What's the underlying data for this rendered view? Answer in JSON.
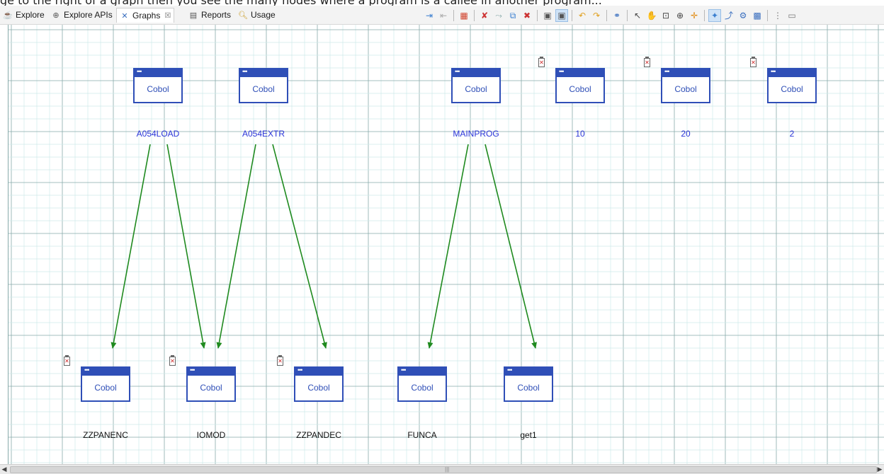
{
  "tabs": [
    {
      "label": "Explore",
      "icon": "cup-icon"
    },
    {
      "label": "Explore APIs",
      "icon": "api-icon"
    },
    {
      "label": "Graphs",
      "icon": "graph-icon",
      "close": "☒"
    },
    {
      "label": "Reports",
      "icon": "report-icon"
    },
    {
      "label": "Usage",
      "icon": "usage-icon"
    }
  ],
  "topcut_text": "ge to the right of a graph then you see the many nodes where a program is a callee in another program...",
  "graph": {
    "nodes": [
      {
        "id": "A054LOAD",
        "box_label": "Cobol",
        "name": "A054LOAD",
        "error": false,
        "label_color": "blue"
      },
      {
        "id": "A054EXTR",
        "box_label": "Cobol",
        "name": "A054EXTR",
        "error": false,
        "label_color": "blue"
      },
      {
        "id": "MAINPROG",
        "box_label": "Cobol",
        "name": "MAINPROG",
        "error": false,
        "label_color": "blue"
      },
      {
        "id": "10",
        "box_label": "Cobol",
        "name": "10",
        "error": true,
        "label_color": "blue"
      },
      {
        "id": "20",
        "box_label": "Cobol",
        "name": "20",
        "error": true,
        "label_color": "blue"
      },
      {
        "id": "2",
        "box_label": "Cobol",
        "name": "2",
        "error": true,
        "label_color": "blue"
      },
      {
        "id": "ZZPANENC",
        "box_label": "Cobol",
        "name": "ZZPANENC",
        "error": true,
        "label_color": "black"
      },
      {
        "id": "IOMOD",
        "box_label": "Cobol",
        "name": "IOMOD",
        "error": true,
        "label_color": "black"
      },
      {
        "id": "ZZPANDEC",
        "box_label": "Cobol",
        "name": "ZZPANDEC",
        "error": true,
        "label_color": "black"
      },
      {
        "id": "FUNCA",
        "box_label": "Cobol",
        "name": "FUNCA",
        "error": false,
        "label_color": "black"
      },
      {
        "id": "get1",
        "box_label": "Cobol",
        "name": "get1",
        "error": false,
        "label_color": "black"
      }
    ],
    "edges": [
      {
        "from": "A054LOAD",
        "to": "ZZPANENC"
      },
      {
        "from": "A054LOAD",
        "to": "IOMOD"
      },
      {
        "from": "A054EXTR",
        "to": "IOMOD"
      },
      {
        "from": "A054EXTR",
        "to": "ZZPANDEC"
      },
      {
        "from": "MAINPROG",
        "to": "FUNCA"
      },
      {
        "from": "MAINPROG",
        "to": "get1"
      }
    ],
    "colors": {
      "node": "#2f4fb7",
      "edge": "#1f8a1f",
      "grid_minor": "#cfeaea",
      "grid_major": "#88aaaa",
      "label_blue": "#2b35d8"
    }
  },
  "scrollbar": {
    "left_arrow": "◀",
    "right_arrow": "▶",
    "grip": "|||"
  }
}
